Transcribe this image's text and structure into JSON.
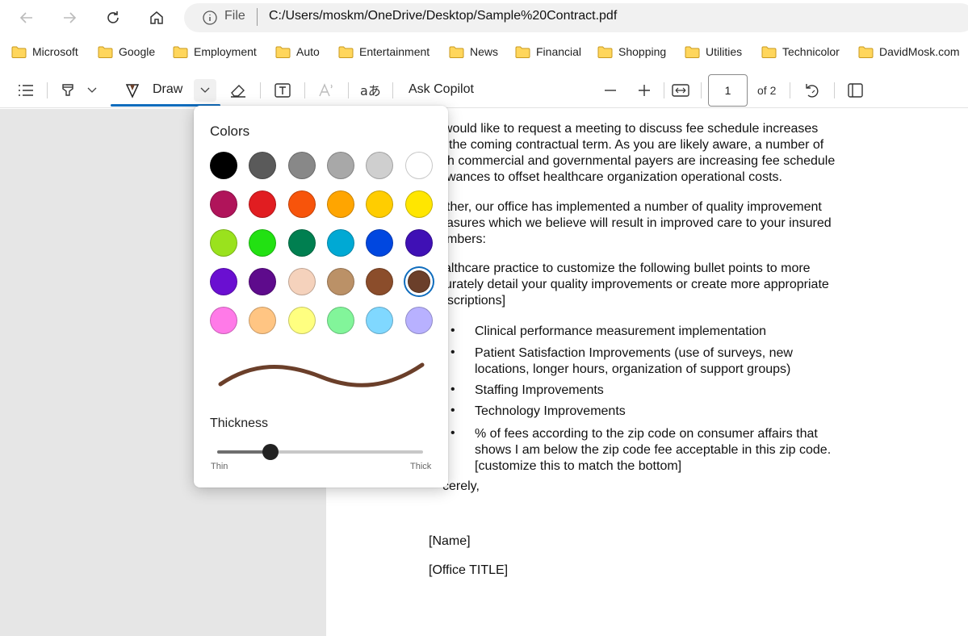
{
  "address_bar": {
    "file_label": "File",
    "url": "C:/Users/moskm/OneDrive/Desktop/Sample%20Contract.pdf"
  },
  "bookmarks": [
    {
      "label": "Microsoft"
    },
    {
      "label": "Google"
    },
    {
      "label": "Employment"
    },
    {
      "label": "Auto"
    },
    {
      "label": "Entertainment"
    },
    {
      "label": "News"
    },
    {
      "label": "Financial"
    },
    {
      "label": "Shopping"
    },
    {
      "label": "Utilities"
    },
    {
      "label": "Technicolor"
    },
    {
      "label": "DavidMosk.com"
    }
  ],
  "toolbar": {
    "draw_label": "Draw",
    "ask_copilot": "Ask Copilot",
    "page_current": "1",
    "page_of": "of 2"
  },
  "flyout": {
    "colors_title": "Colors",
    "selected_color": "#6b3f2a",
    "swatches": [
      [
        "#000000",
        "#5a5a5a",
        "#888888",
        "#a8a8a8",
        "#cfcfcf",
        "#ffffff"
      ],
      [
        "#b0145a",
        "#e11d21",
        "#f7540b",
        "#ffa500",
        "#ffcd00",
        "#ffe600"
      ],
      [
        "#9ae21d",
        "#22e112",
        "#007f50",
        "#00a9d4",
        "#0047e0",
        "#3f10b5"
      ],
      [
        "#6a0fd1",
        "#5e0b8c",
        "#f5d2bc",
        "#bb9167",
        "#8b4d2b",
        "#6b3f2a"
      ],
      [
        "#ff7ae8",
        "#ffc583",
        "#ffff80",
        "#82f59a",
        "#80d8ff",
        "#b8b1ff"
      ]
    ],
    "thickness_title": "Thickness",
    "thickness_level": 0.26,
    "thin_label": "Thin",
    "thick_label": "Thick"
  },
  "document": {
    "para1": [
      "would like to request a meeting to discuss fee schedule increases",
      "the coming contractual term. As you are likely aware, a number of",
      "h commercial and governmental payers are increasing fee schedule",
      "wances to offset healthcare organization operational costs."
    ],
    "para2": [
      "ther, our office has implemented a number of quality improvement",
      "asures which we believe will result in improved care to your insured",
      "mbers:"
    ],
    "para3": [
      "althcare practice to customize the following bullet points to more",
      "urately detail your quality improvements or create more appropriate",
      "scriptions]"
    ],
    "bullets": [
      [
        "Clinical performance measurement implementation"
      ],
      [
        "Patient Satisfaction Improvements (use of surveys, new",
        "locations, longer hours, organization of support groups)"
      ],
      [
        "Staffing Improvements"
      ],
      [
        "Technology Improvements"
      ],
      [
        "% of fees according to the zip code on consumer affairs that",
        "shows I am below the zip code fee acceptable in this zip code.",
        "[customize this to match the bottom]"
      ]
    ],
    "closing": "cerely,",
    "name": "[Name]",
    "office_title": "[Office TITLE]"
  }
}
